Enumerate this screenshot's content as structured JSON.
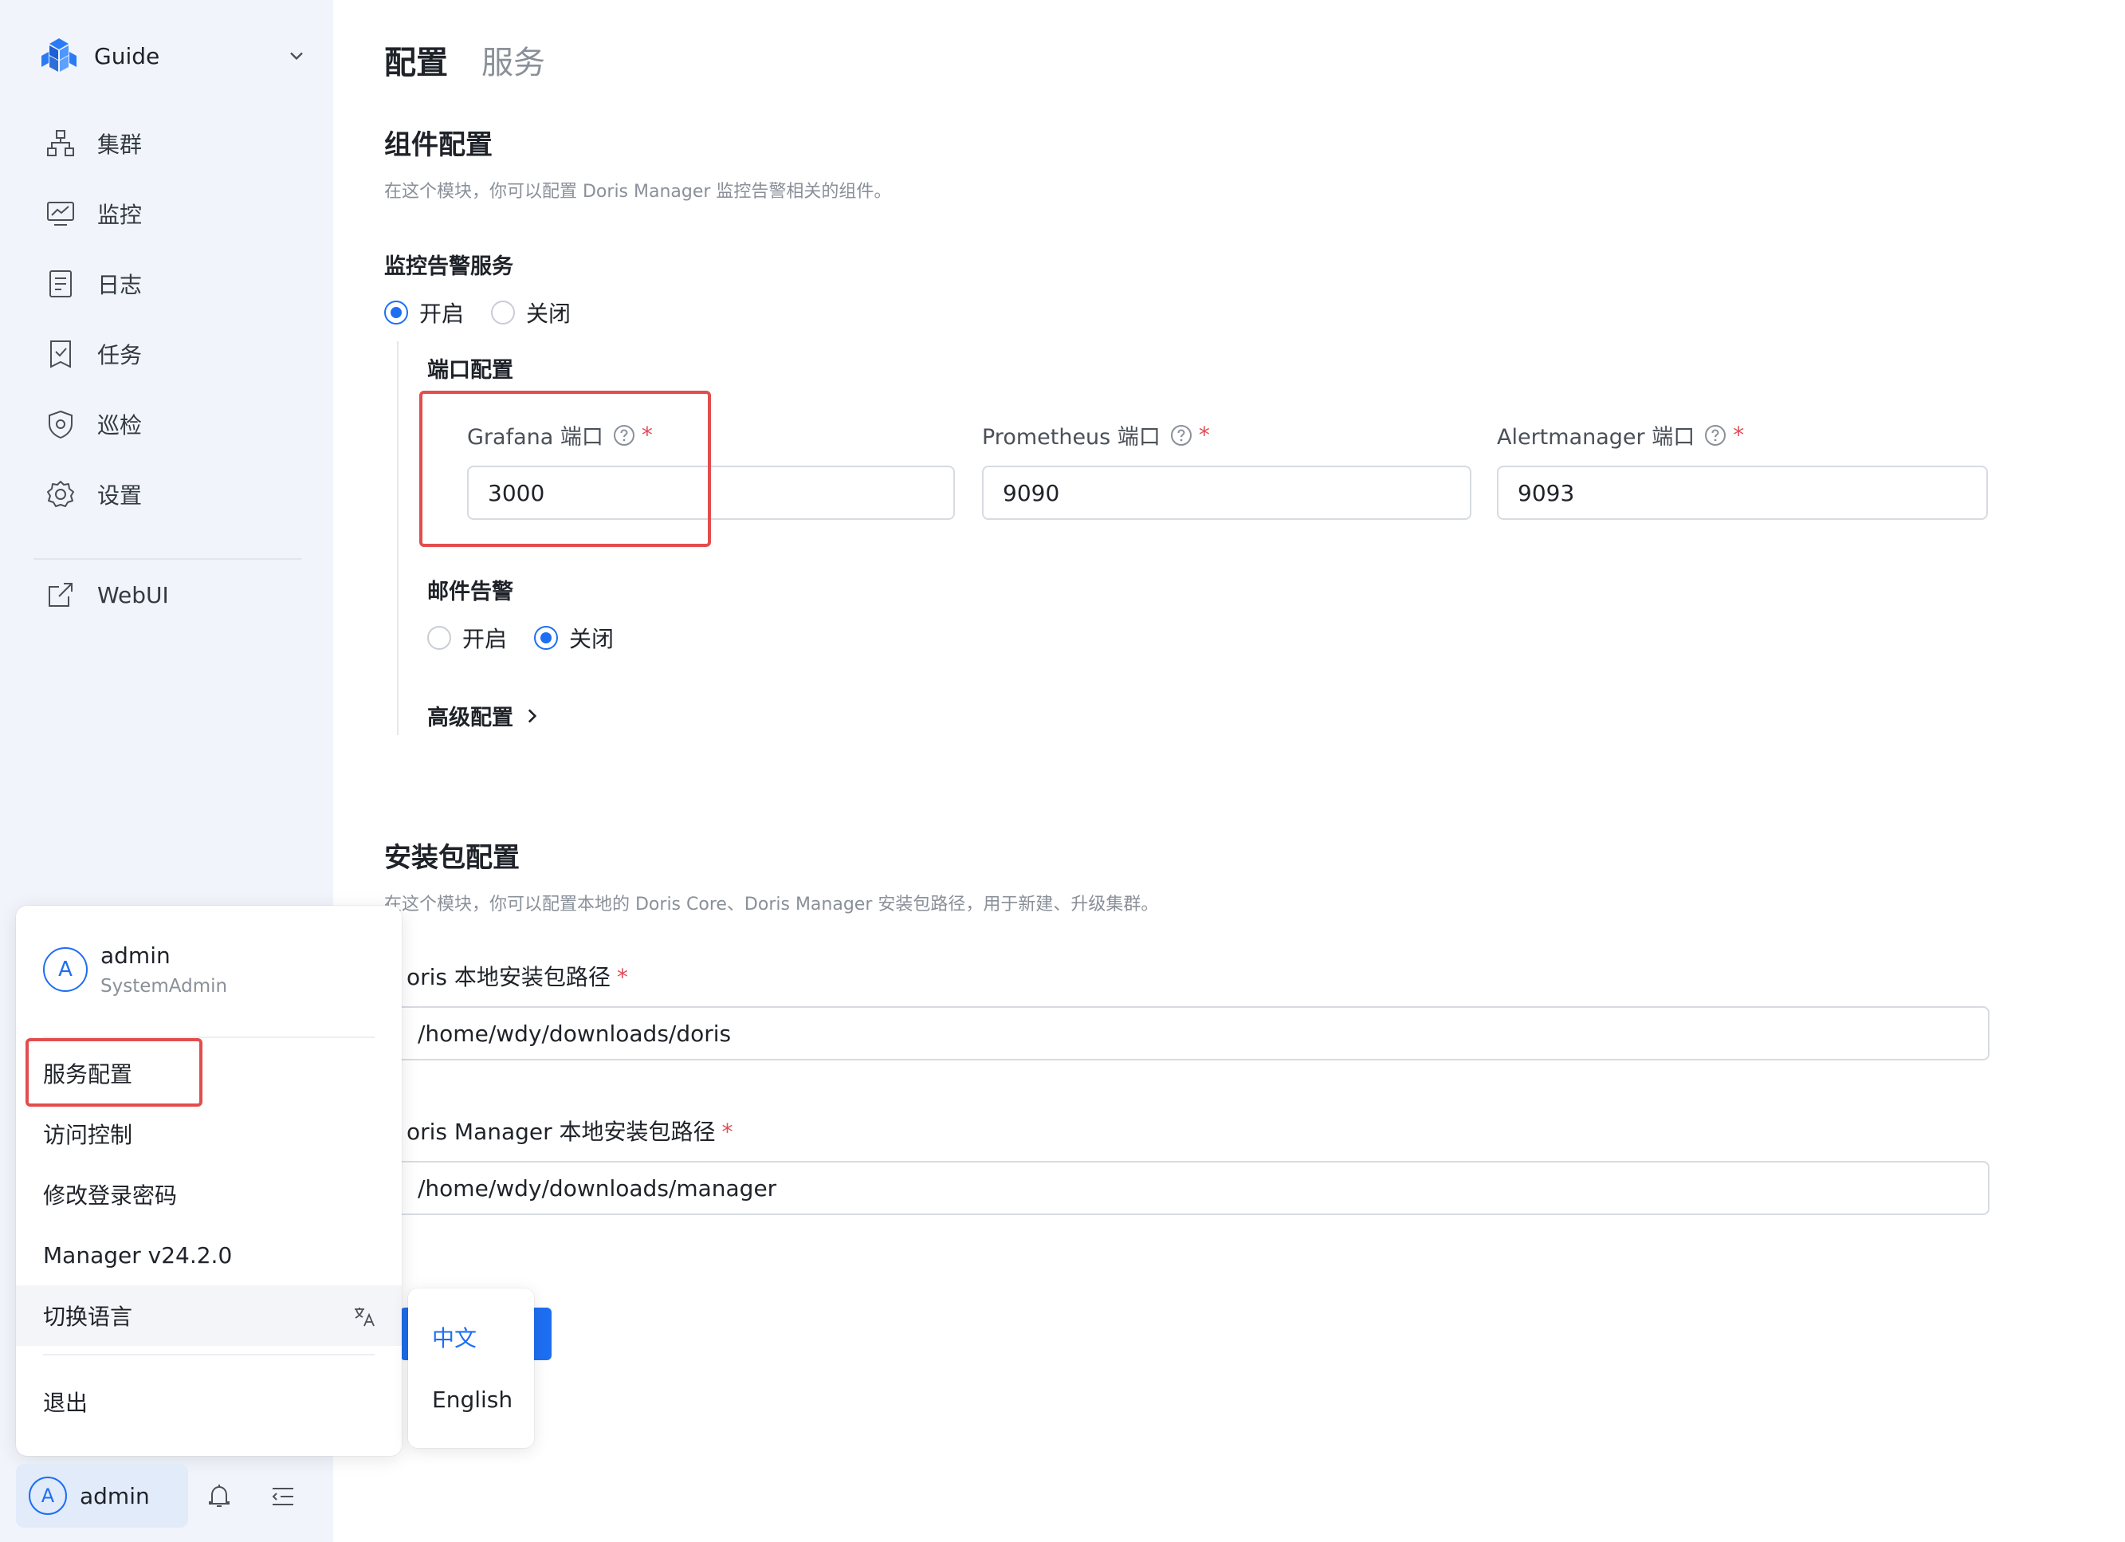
{
  "app": {
    "name": "Guide"
  },
  "sidebar": {
    "items": [
      {
        "label": "集群",
        "icon": "cluster-icon"
      },
      {
        "label": "监控",
        "icon": "monitor-icon"
      },
      {
        "label": "日志",
        "icon": "log-icon"
      },
      {
        "label": "任务",
        "icon": "task-icon"
      },
      {
        "label": "巡检",
        "icon": "inspection-icon"
      },
      {
        "label": "设置",
        "icon": "settings-icon"
      }
    ],
    "webui_label": "WebUI"
  },
  "tabs": [
    {
      "label": "配置",
      "active": true
    },
    {
      "label": "服务",
      "active": false
    }
  ],
  "component_config": {
    "title": "组件配置",
    "description": "在这个模块，你可以配置 Doris Manager 监控告警相关的组件。",
    "monitor_service": {
      "title": "监控告警服务",
      "options": [
        "开启",
        "关闭"
      ],
      "selected": "开启"
    },
    "port_config": {
      "title": "端口配置",
      "grafana": {
        "label": "Grafana 端口",
        "value": "3000"
      },
      "prometheus": {
        "label": "Prometheus 端口",
        "value": "9090"
      },
      "alertmanager": {
        "label": "Alertmanager 端口",
        "value": "9093"
      },
      "required_mark": "*"
    },
    "email_alert": {
      "title": "邮件告警",
      "options": [
        "开启",
        "关闭"
      ],
      "selected": "关闭"
    },
    "advanced_label": "高级配置"
  },
  "package_config": {
    "title": "安装包配置",
    "description": "在这个模块，你可以配置本地的 Doris Core、Doris Manager 安装包路径，用于新建、升级集群。",
    "doris_path": {
      "label": "oris 本地安装包路径",
      "value": "/home/wdy/downloads/doris"
    },
    "manager_path": {
      "label": "oris Manager 本地安装包路径",
      "value": "/home/wdy/downloads/manager"
    }
  },
  "user_menu": {
    "avatar_letter": "A",
    "name": "admin",
    "role": "SystemAdmin",
    "items": [
      "服务配置",
      "访问控制",
      "修改登录密码",
      "Manager v24.2.0",
      "切换语言"
    ],
    "logout": "退出"
  },
  "language_menu": {
    "options": [
      "中文",
      "English"
    ],
    "selected": "中文"
  },
  "bottom_bar": {
    "avatar_letter": "A",
    "user_name": "admin"
  },
  "colors": {
    "accent": "#1d6ff2",
    "highlight": "#e34d4d",
    "sidebar_bg": "#f1f5fb"
  }
}
